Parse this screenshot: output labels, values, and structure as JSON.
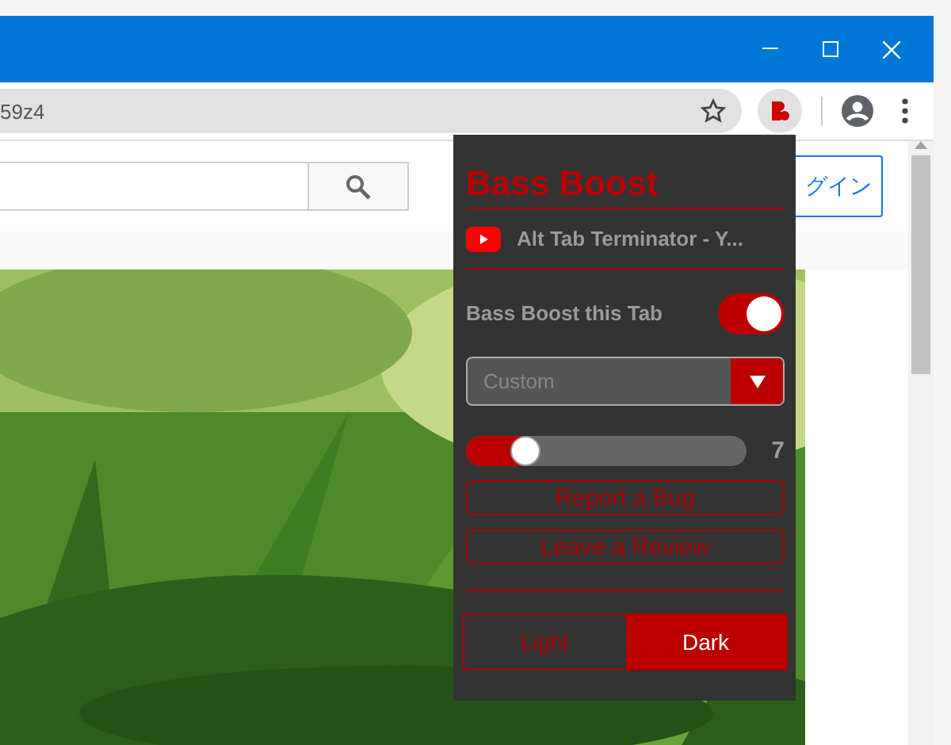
{
  "browser": {
    "address": "59z4"
  },
  "page": {
    "login_button": "グイン"
  },
  "popup": {
    "title": "Bass Boost",
    "tab_title": "Alt Tab Terminator - Y...",
    "toggle": {
      "label": "Bass Boost this Tab",
      "on": true
    },
    "preset": {
      "value": "Custom"
    },
    "slider": {
      "level": 0.21,
      "reading": "7"
    },
    "buttons": [
      "Report a Bug",
      "Leave a Review"
    ],
    "theme_options": [
      {
        "label": "Light",
        "selected": false
      },
      {
        "label": "Dark",
        "selected": true
      }
    ]
  }
}
